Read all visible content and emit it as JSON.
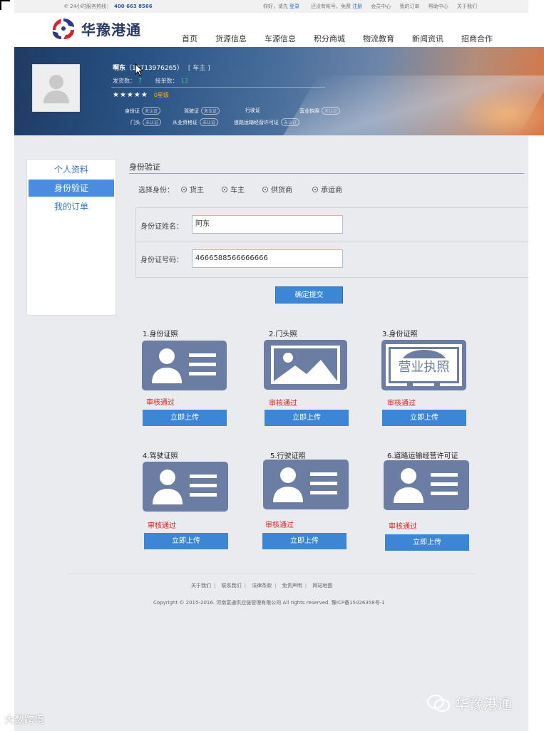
{
  "topbar": {
    "hotline_label": "24小时服务热线：",
    "hotline_number": "400 663 8566",
    "greeting": "你好，请先",
    "login": "登录",
    "no_account": "还没有帐号，免费",
    "register": "注册",
    "links": [
      "会员中心",
      "我的订单",
      "帮助中心",
      "关于我们"
    ]
  },
  "header": {
    "logo_text": "华豫港通",
    "nav": [
      "首页",
      "货源信息",
      "车源信息",
      "积分商城",
      "物流教育",
      "新闻资讯",
      "招商合作"
    ]
  },
  "profile": {
    "name": "啊东",
    "phone_open": "（",
    "phone": "13713976265",
    "phone_close": "）",
    "role": "[ 车主 ]",
    "shipments_label": "发货数：",
    "shipments": "7",
    "orders_label": "接单数：",
    "orders": "12",
    "stars": "★★★★★",
    "level": "0星级",
    "certs": [
      {
        "label": "身份证",
        "status": "未认证"
      },
      {
        "label": "驾驶证",
        "status": "未认证"
      },
      {
        "label": "行驶证",
        "status": ""
      },
      {
        "label": "营业执照",
        "status": "未认证"
      },
      {
        "label": "门头",
        "status": "未认证"
      },
      {
        "label": "从业资格证",
        "status": "未认证"
      },
      {
        "label": "道路运输经营许可证",
        "status": "未认证"
      }
    ]
  },
  "sidebar": {
    "items": [
      {
        "label": "个人资料",
        "active": false
      },
      {
        "label": "身份验证",
        "active": true
      },
      {
        "label": "我的订单",
        "active": false
      }
    ]
  },
  "form": {
    "section_title": "身份验证",
    "role_label": "选择身份：",
    "roles": [
      "货主",
      "车主",
      "供货商",
      "承运商"
    ],
    "name_label": "身份证姓名：",
    "name_value": "阿东",
    "id_label": "身份证号码：",
    "id_value": "4666588566666666",
    "submit": "确定提交"
  },
  "uploads": [
    {
      "title": "1.身份证照",
      "icon": "id-card-icon",
      "status": "审核通过",
      "button": "立即上传"
    },
    {
      "title": "2.门头照",
      "icon": "image-placeholder-icon",
      "status": "审核通过",
      "button": "立即上传"
    },
    {
      "title": "3.身份证照",
      "icon": "business-license-icon",
      "icon_text": "营业执照",
      "status": "审核通过",
      "button": "立即上传"
    },
    {
      "title": "4.驾驶证照",
      "icon": "id-card-icon",
      "status": "审核通过",
      "button": "立即上传"
    },
    {
      "title": "5.行驶证照",
      "icon": "id-card-icon",
      "status": "审核通过",
      "button": "立即上传"
    },
    {
      "title": "6.道路运输经营许可证",
      "icon": "id-card-icon",
      "status": "审核通过",
      "button": "立即上传"
    }
  ],
  "footer": {
    "links": [
      "关于我们",
      "联系我们",
      "法律条款",
      "免责声明",
      "网站地图"
    ],
    "separator": "|",
    "copyright": "Copyright © 2015-2016. 河南富通供应链管理有限公司 All rights reserved. 豫ICP备15026358号-1"
  },
  "watermarks": {
    "right": "华豫港通",
    "left": "大数跨境"
  }
}
